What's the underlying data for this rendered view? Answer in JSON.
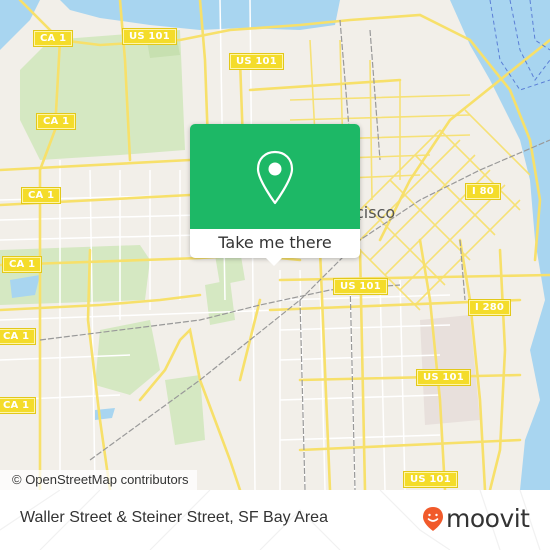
{
  "map": {
    "city_label": "cisco",
    "colors": {
      "land": "#f2efe9",
      "water": "#a8d5f0",
      "park": "#d5e8c2",
      "road": "#f7e06a",
      "minor_road": "#ffffff",
      "rail": "#999999",
      "shield": "#f4dc2a"
    },
    "shields": [
      {
        "label": "CA 1"
      },
      {
        "label": "US 101"
      },
      {
        "label": "US 101"
      },
      {
        "label": "CA 1"
      },
      {
        "label": "CA 1"
      },
      {
        "label": "I 80"
      },
      {
        "label": "CA 1"
      },
      {
        "label": "CA 1"
      },
      {
        "label": "US 101"
      },
      {
        "label": "I 280"
      },
      {
        "label": "CA 1"
      },
      {
        "label": "US 101"
      },
      {
        "label": "US 101"
      }
    ],
    "attribution": "© OpenStreetMap contributors"
  },
  "popup": {
    "icon": "map-pin-icon",
    "button_label": "Take me there",
    "accent_color": "#1db866"
  },
  "footer": {
    "location_title": "Waller Street & Steiner Street, SF Bay Area",
    "brand_name": "moovit",
    "brand_color": "#f15a2b"
  }
}
